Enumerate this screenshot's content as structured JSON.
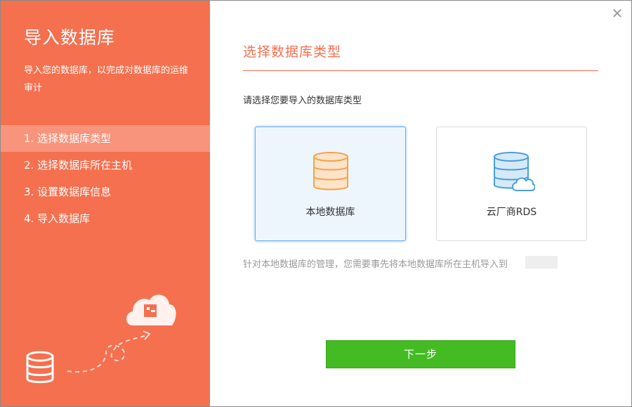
{
  "sidebar": {
    "title": "导入数据库",
    "description": "导入您的数据库，以完成对数据库的运维审计",
    "steps": [
      {
        "label": "1. 选择数据库类型",
        "active": true
      },
      {
        "label": "2. 选择数据库所在主机",
        "active": false
      },
      {
        "label": "3. 设置数据库信息",
        "active": false
      },
      {
        "label": "4. 导入数据库",
        "active": false
      }
    ]
  },
  "main": {
    "close_icon": "close-icon",
    "section_title": "选择数据库类型",
    "prompt": "请选择您要导入的数据库类型",
    "options": [
      {
        "label": "本地数据库",
        "icon": "database-icon",
        "selected": true
      },
      {
        "label": "云厂商RDS",
        "icon": "cloud-database-icon",
        "selected": false
      }
    ],
    "hint": "针对本地数据库的管理，您需要事先将本地数据库所在主机导入到",
    "next_label": "下一步"
  },
  "colors": {
    "accent": "#f4704f",
    "primary_button": "#44bb23",
    "selected_border": "#6aaee8",
    "db_orange": "#f5a24b",
    "db_blue": "#4a9fdc"
  }
}
